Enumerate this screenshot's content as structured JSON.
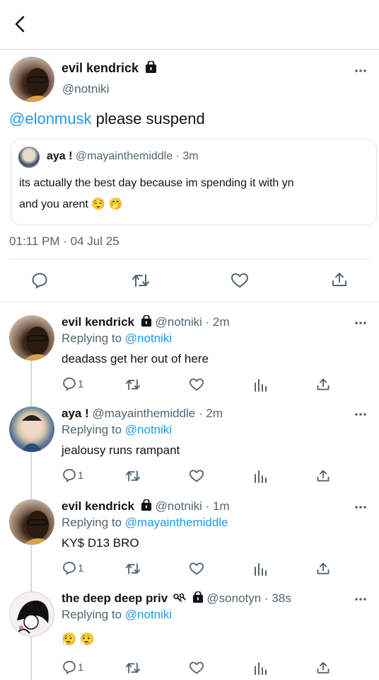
{
  "main_tweet": {
    "author_name": "evil kendrick",
    "author_handle": "@notniki",
    "mention": "@elonmusk",
    "text": " please suspend",
    "timestamp": "01:11 PM · 04 Jul 25",
    "quote": {
      "author_name": "aya !",
      "author_handle": "@mayainthemiddle",
      "time": "· 3m",
      "text_line1": "its actually the best day because im spending it with yn",
      "text_line2": "and you arent 😌 🤭"
    }
  },
  "replies": [
    {
      "name": "evil kendrick",
      "handle": "@notniki · 2m",
      "replying_prefix": "Replying to ",
      "replying_to": "@notniki",
      "text": "deadass get her out of here",
      "reply_count": "1"
    },
    {
      "name": "aya !",
      "handle": "@mayainthemiddle · 2m",
      "replying_prefix": "Replying to ",
      "replying_to": "@notniki",
      "text": "jealousy runs rampant",
      "reply_count": "1"
    },
    {
      "name": "evil kendrick",
      "handle": "@notniki · 1m",
      "replying_prefix": "Replying to ",
      "replying_to": "@mayainthemiddle",
      "text": "KY$ D13 BRO",
      "reply_count": "1"
    },
    {
      "name": "the deep deep priv",
      "handle": "@sonotyn · 38s",
      "replying_prefix": "Replying to ",
      "replying_to": "@notniki",
      "text": "😮‍💨 😮‍💨",
      "reply_count": "1"
    }
  ],
  "colors": {
    "link": "#1d9bf0",
    "muted": "#536471",
    "text": "#0f1419"
  }
}
